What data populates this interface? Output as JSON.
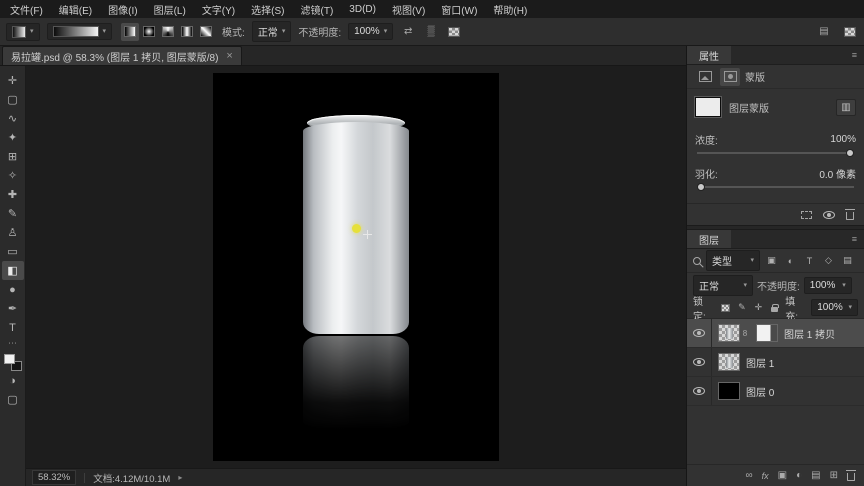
{
  "menu": {
    "items": [
      "文件(F)",
      "编辑(E)",
      "图像(I)",
      "图层(L)",
      "文字(Y)",
      "选择(S)",
      "滤镜(T)",
      "3D(D)",
      "视图(V)",
      "窗口(W)",
      "帮助(H)"
    ]
  },
  "options": {
    "mode_label": "模式:",
    "mode_value": "正常",
    "opacity_label": "不透明度:",
    "opacity_value": "100%"
  },
  "tab": {
    "title": "易拉罐.psd @ 58.3% (图层 1 拷贝, 图层蒙版/8)",
    "close": "×"
  },
  "tools": [
    {
      "name": "move-tool",
      "glyph": "✛"
    },
    {
      "name": "marquee-tool",
      "glyph": "▢"
    },
    {
      "name": "lasso-tool",
      "glyph": "∿"
    },
    {
      "name": "magic-wand-tool",
      "glyph": "✦"
    },
    {
      "name": "crop-tool",
      "glyph": "⊞"
    },
    {
      "name": "eyedropper-tool",
      "glyph": "✧"
    },
    {
      "name": "healing-brush-tool",
      "glyph": "✚"
    },
    {
      "name": "brush-tool",
      "glyph": "✎"
    },
    {
      "name": "clone-stamp-tool",
      "glyph": "♙"
    },
    {
      "name": "eraser-tool",
      "glyph": "▭"
    },
    {
      "name": "gradient-tool",
      "glyph": "◧"
    },
    {
      "name": "blur-tool",
      "glyph": "●"
    },
    {
      "name": "pen-tool",
      "glyph": "✒"
    },
    {
      "name": "type-tool",
      "glyph": "T"
    },
    {
      "name": "quick-mask-tool",
      "glyph": "◑"
    },
    {
      "name": "screen-mode-tool",
      "glyph": "▢"
    }
  ],
  "toolbar": {
    "more_dots": "⋯"
  },
  "properties": {
    "title": "属性",
    "masks_label": "蒙版",
    "layer_mask_label": "图层蒙版",
    "density_label": "浓度:",
    "density_value": "100%",
    "feather_label": "羽化:",
    "feather_value": "0.0 像素"
  },
  "layers_panel": {
    "title": "图层",
    "filter_label": "类型",
    "blend_mode": "正常",
    "opacity_label": "不透明度:",
    "opacity_value": "100%",
    "lock_label": "锁定:",
    "fill_label": "填充:",
    "fill_value": "100%",
    "fx_label": "fx",
    "items": [
      {
        "name": "图层 1 拷贝",
        "selected": true
      },
      {
        "name": "图层 1",
        "selected": false
      },
      {
        "name": "图层 0",
        "selected": false
      }
    ]
  },
  "status": {
    "zoom": "58.32%",
    "doc": "文档:4.12M/10.1M"
  },
  "glyphs": {
    "caret": "▾",
    "menu": "≡",
    "mask_link": "8",
    "pixel_filter": "▣",
    "adjust_filter": "◐",
    "type_filter": "T",
    "shape_filter": "◇",
    "smart_filter": "▤",
    "reverse": "⇄",
    "dither": "▒",
    "link": "∞",
    "adjustment": "◐",
    "group": "▤",
    "new_layer": "⊞",
    "add_mask": "▣",
    "mask_btn": "▥",
    "brush_lock": "✎",
    "move_lock": "✛",
    "status_caret": "▸"
  },
  "colors": {
    "cursor_dot": "#e6e03a",
    "canvas_bg": "#000000",
    "selected_row": "#4c4c4c"
  }
}
